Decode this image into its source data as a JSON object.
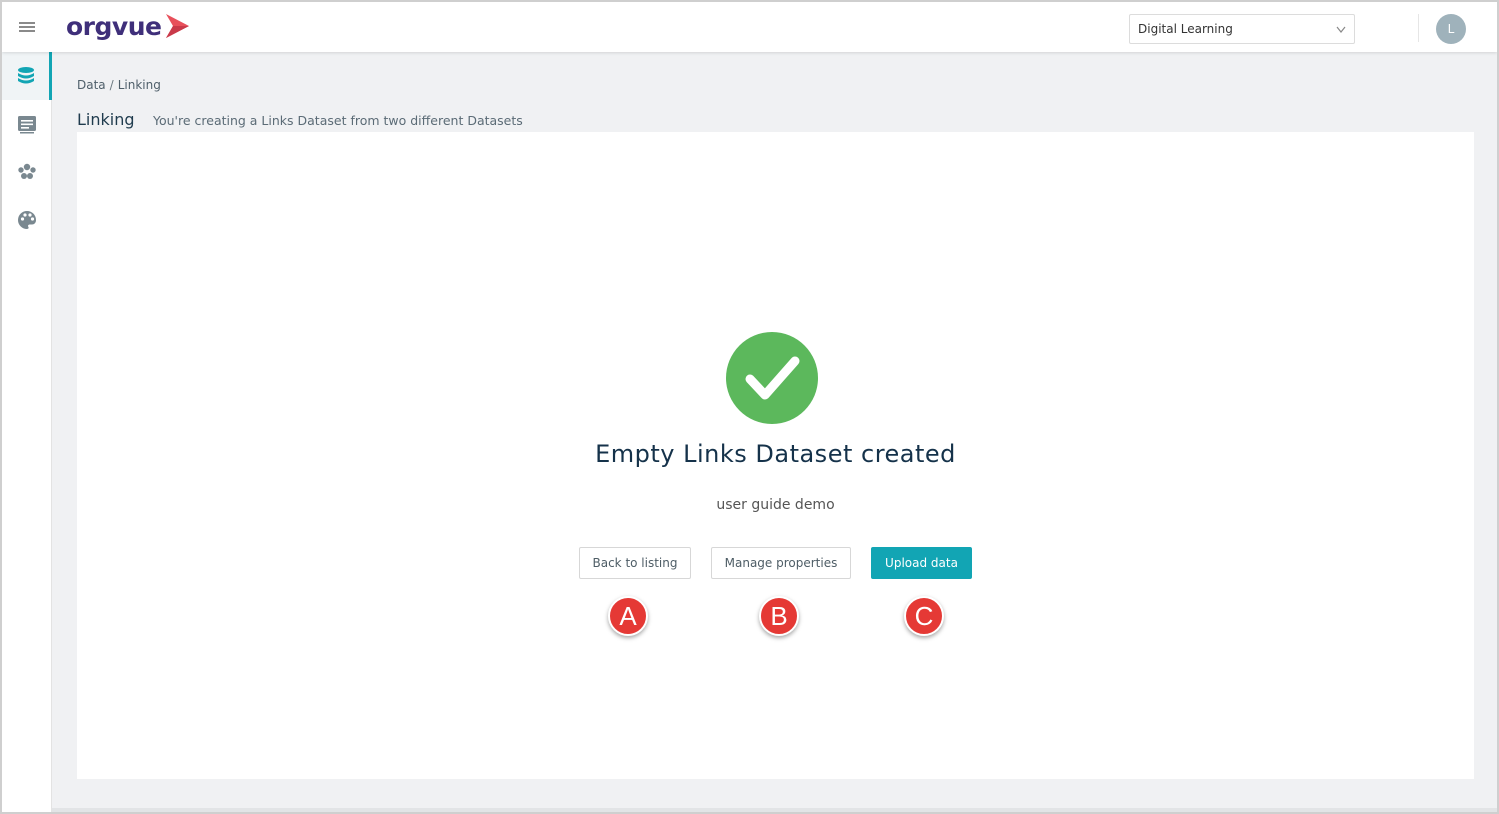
{
  "app": {
    "logo_text": "orgvue",
    "workspace": "Digital Learning",
    "user_initial": "L"
  },
  "sidebar": {
    "items": [
      {
        "icon": "database-icon",
        "active": true
      },
      {
        "icon": "document-list-icon",
        "active": false
      },
      {
        "icon": "people-group-icon",
        "active": false
      },
      {
        "icon": "palette-icon",
        "active": false
      }
    ]
  },
  "breadcrumb": {
    "root": "Data",
    "separator": "/",
    "current": "Linking"
  },
  "page": {
    "title": "Linking",
    "subtitle": "You're creating a Links Dataset from two different Datasets"
  },
  "result": {
    "title": "Empty Links Dataset created",
    "dataset_name": "user guide demo",
    "back_label": "Back to listing",
    "manage_label": "Manage properties",
    "upload_label": "Upload data"
  },
  "markers": {
    "a": "A",
    "b": "B",
    "c": "C"
  },
  "colors": {
    "accent": "#12a5b4",
    "success": "#5cb85c",
    "marker": "#e53935",
    "logo": "#3f2f7a",
    "logo_mark": "#e8505b"
  }
}
